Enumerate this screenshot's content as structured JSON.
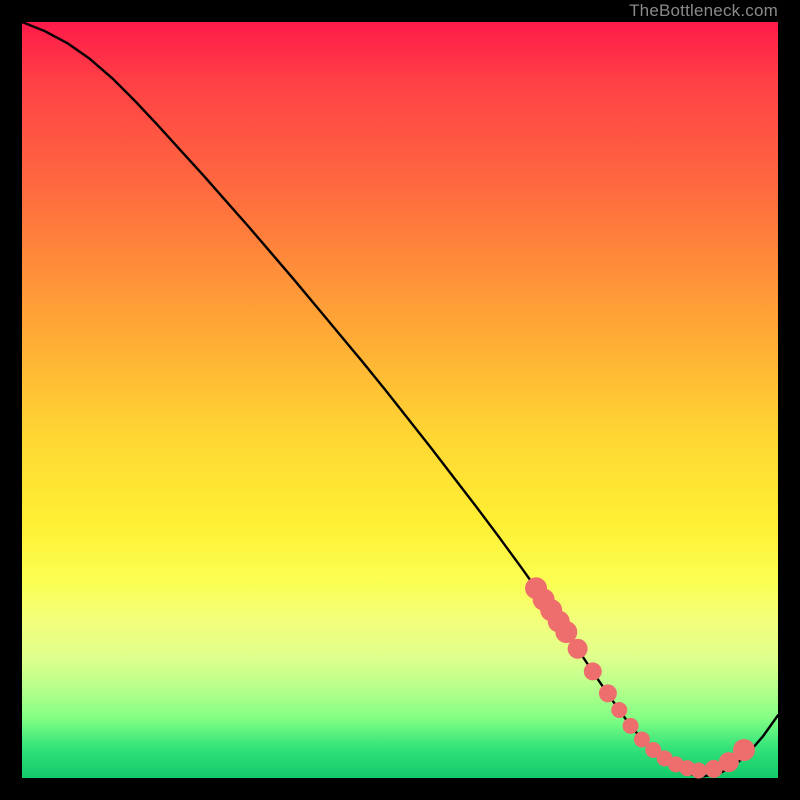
{
  "watermark": "TheBottleneck.com",
  "colors": {
    "line": "#000000",
    "dot_fill": "#ee6e6e",
    "dot_stroke": "#b84a4a"
  },
  "chart_data": {
    "type": "line",
    "title": "",
    "xlabel": "",
    "ylabel": "",
    "xlim": [
      0,
      100
    ],
    "ylim": [
      0,
      100
    ],
    "series": [
      {
        "name": "curve",
        "x": [
          0,
          3,
          6,
          9,
          12,
          15,
          18,
          21,
          24,
          27,
          30,
          33,
          36,
          39,
          42,
          45,
          48,
          51,
          54,
          57,
          60,
          63,
          66,
          68,
          70,
          72,
          74,
          76,
          78,
          80,
          82,
          84,
          86,
          88,
          90,
          92,
          94,
          96,
          98,
          100
        ],
        "y": [
          100,
          98.8,
          97.2,
          95.1,
          92.5,
          89.5,
          86.3,
          83.0,
          79.7,
          76.3,
          72.9,
          69.4,
          65.9,
          62.3,
          58.7,
          55.1,
          51.4,
          47.6,
          43.8,
          39.9,
          36.0,
          32.0,
          27.9,
          25.1,
          22.2,
          19.3,
          16.3,
          13.3,
          10.4,
          7.6,
          5.1,
          3.0,
          1.5,
          0.6,
          0.2,
          0.5,
          1.5,
          3.2,
          5.5,
          8.3
        ]
      }
    ],
    "dots": {
      "name": "highlight-dots",
      "x": [
        68.0,
        69.0,
        70.0,
        71.0,
        72.0,
        73.5,
        75.5,
        77.5,
        79.0,
        80.5,
        82.0,
        83.5,
        85.0,
        86.5,
        88.0,
        89.5,
        91.5,
        93.5,
        95.5
      ],
      "y": [
        25.1,
        23.6,
        22.2,
        20.7,
        19.3,
        17.1,
        14.1,
        11.2,
        9.0,
        6.9,
        5.1,
        3.7,
        2.6,
        1.8,
        1.3,
        1.0,
        1.2,
        2.1,
        3.7
      ],
      "r": [
        11,
        11,
        11,
        11,
        11,
        10,
        9,
        9,
        8,
        8,
        8,
        8,
        8,
        8,
        8,
        8,
        9,
        10,
        11
      ]
    }
  }
}
